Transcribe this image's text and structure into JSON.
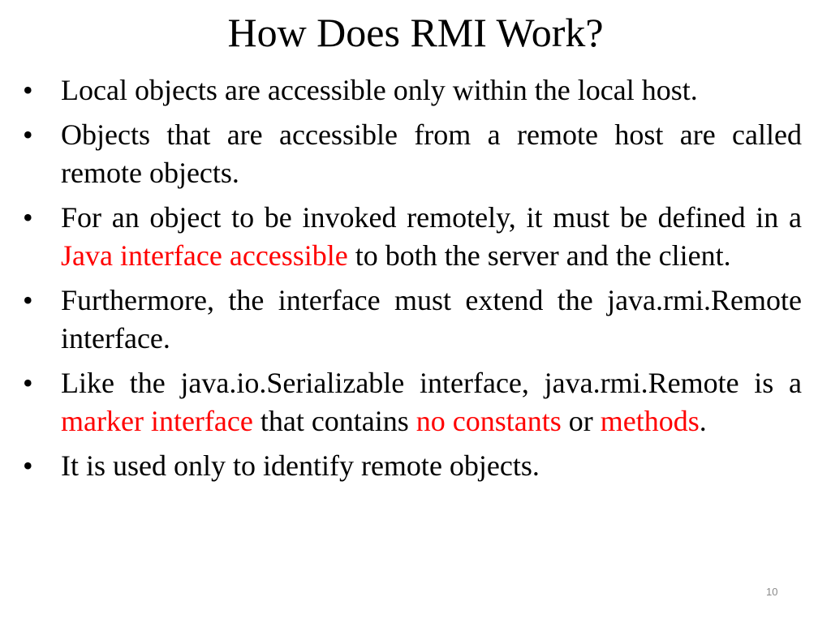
{
  "slide": {
    "title": "How Does RMI Work?",
    "page_number": "10",
    "accent_color": "#ff0000",
    "bullets": [
      {
        "segments": [
          {
            "text": "Local objects are accessible only within the local host.",
            "highlight": false
          }
        ]
      },
      {
        "segments": [
          {
            "text": "Objects that are accessible from a remote host are called remote objects.",
            "highlight": false
          }
        ]
      },
      {
        "segments": [
          {
            "text": "For an object to be invoked remotely, it must be defined in a ",
            "highlight": false
          },
          {
            "text": "Java interface accessible",
            "highlight": true
          },
          {
            "text": " to both the server and the client.",
            "highlight": false
          }
        ]
      },
      {
        "segments": [
          {
            "text": "Furthermore, the interface must extend the java.rmi.Remote interface.",
            "highlight": false
          }
        ]
      },
      {
        "segments": [
          {
            "text": "Like the java.io.Serializable interface, java.rmi.Remote is a ",
            "highlight": false
          },
          {
            "text": "marker interface",
            "highlight": true
          },
          {
            "text": " that contains ",
            "highlight": false
          },
          {
            "text": "no constants",
            "highlight": true
          },
          {
            "text": " or ",
            "highlight": false
          },
          {
            "text": "methods",
            "highlight": true
          },
          {
            "text": ".",
            "highlight": false
          }
        ]
      },
      {
        "segments": [
          {
            "text": "It is used only to identify remote objects.",
            "highlight": false
          }
        ]
      }
    ],
    "bullet_glyph": "•"
  }
}
